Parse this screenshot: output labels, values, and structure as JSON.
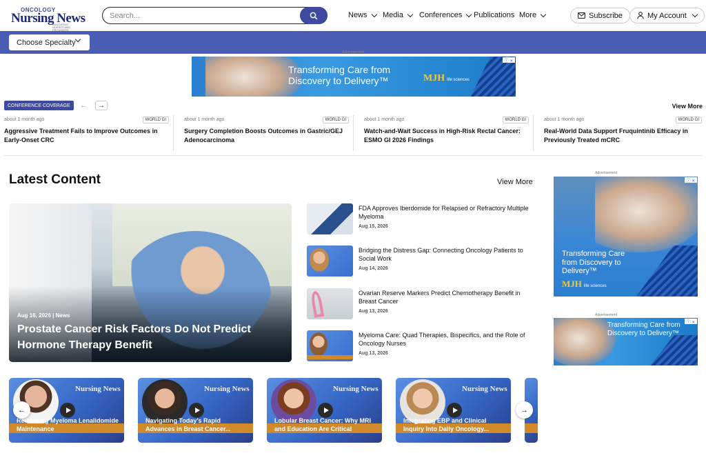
{
  "header": {
    "logo_top": "ONCOLOGY",
    "logo_main": "Nursing News",
    "logo_sub": "EDUCATING NURSES AND PROVIDERS",
    "search_placeholder": "Search...",
    "nav": [
      {
        "label": "News",
        "has_menu": true
      },
      {
        "label": "Media",
        "has_menu": true
      },
      {
        "label": "Conferences",
        "has_menu": true
      },
      {
        "label": "Publications",
        "has_menu": false
      },
      {
        "label": "More",
        "has_menu": true
      }
    ],
    "subscribe": "Subscribe",
    "account": "My Account"
  },
  "specialty": {
    "label": "Choose Specialty"
  },
  "ad_label": "Advertisement",
  "ads": {
    "line1": "Transforming Care from",
    "line2": "Discovery to Delivery™",
    "side_line1": "Transforming Care",
    "side_line2": "from Discovery to",
    "side_line3": "Delivery™",
    "brand": "MJH",
    "brand_sub": "life sciences"
  },
  "coverage": {
    "badge": "CONFERENCE COVERAGE",
    "view_more": "View More",
    "items": [
      {
        "time": "about 1 month ago",
        "tag": "WORLD GI",
        "title": "Aggressive Treatment Fails to Improve Outcomes in Early-Onset CRC"
      },
      {
        "time": "about 1 month ago",
        "tag": "WORLD GI",
        "title": "Surgery Completion Boosts Outcomes in Gastric/GEJ Adenocarcinoma"
      },
      {
        "time": "about 1 month ago",
        "tag": "WORLD GI",
        "title": "Watch-and-Wait Success in High-Risk Rectal Cancer: ESMO GI 2026 Findings"
      },
      {
        "time": "about 1 month ago",
        "tag": "WORLD GI",
        "title": "Real-World Data Support Fruquintinib Efficacy in Previously Treated mCRC"
      }
    ]
  },
  "latest": {
    "title": "Latest Content",
    "view_more": "View More",
    "hero": {
      "meta": "Aug 16, 2026 | News",
      "title": "Prostate Cancer Risk Factors Do Not Predict Hormone Therapy Benefit"
    },
    "items": [
      {
        "title": "FDA Approves Iberdomide for Relapsed or Refractory Multiple Myeloma",
        "date": "Aug 15, 2026"
      },
      {
        "title": "Bridging the Distress Gap: Connecting Oncology Patients to Social Work",
        "date": "Aug 14, 2026"
      },
      {
        "title": "Ovarian Reserve Markers Predict Chemotherapy Benefit in Breast Cancer",
        "date": "Aug 13, 2026"
      },
      {
        "title": "Myeloma Care: Quad Therapies, Bispecifics, and the Role of Oncology Nurses",
        "date": "Aug 13, 2026"
      }
    ]
  },
  "videos": [
    {
      "title": "Rethinking Myeloma Lenalidomide Maintenance"
    },
    {
      "title": "Navigating Today’s Rapid Advances in Breast Cancer..."
    },
    {
      "title": "Lobular Breast Cancer: Why MRI and Education Are Critical"
    },
    {
      "title": "Integrating EBP and Clinical Inquiry Into Daily Oncology..."
    }
  ],
  "colors": {
    "brand": "#3d4aa0",
    "bar": "#4a5cb3"
  }
}
